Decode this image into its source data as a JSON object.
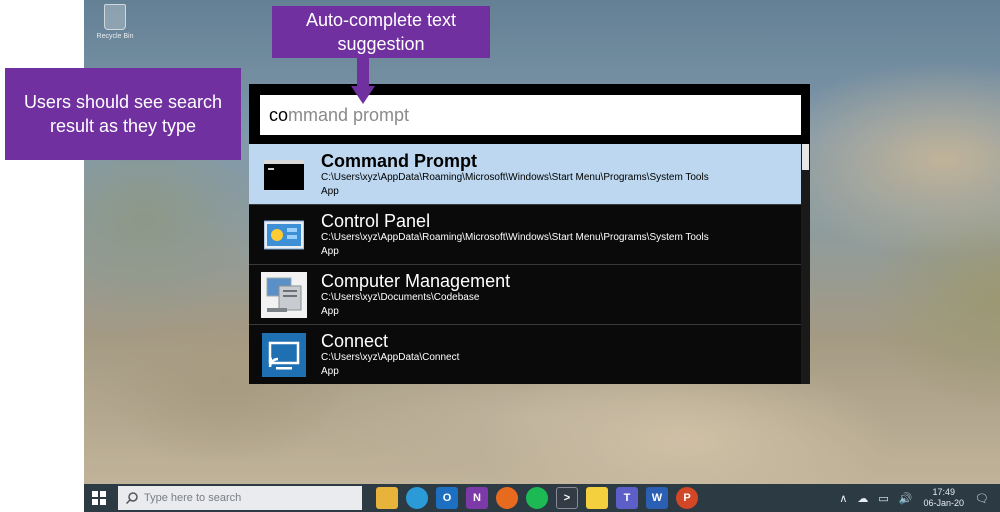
{
  "annotations": {
    "left_callout": "Users should see search result as they type",
    "top_callout": "Auto-complete text suggestion"
  },
  "desktop": {
    "recycle_bin_label": "Recycle Bin"
  },
  "search": {
    "typed": "co",
    "suggestion": "mmand prompt"
  },
  "results": [
    {
      "title": "Command Prompt",
      "path": "C:\\Users\\xyz\\AppData\\Roaming\\Microsoft\\Windows\\Start Menu\\Programs\\System Tools",
      "kind": "App",
      "icon": "command-prompt-icon",
      "selected": true
    },
    {
      "title": "Control Panel",
      "path": "C:\\Users\\xyz\\AppData\\Roaming\\Microsoft\\Windows\\Start Menu\\Programs\\System Tools",
      "kind": "App",
      "icon": "control-panel-icon",
      "selected": false
    },
    {
      "title": "Computer Management",
      "path": "C:\\Users\\xyz\\Documents\\Codebase",
      "kind": "App",
      "icon": "computer-management-icon",
      "selected": false
    },
    {
      "title": "Connect",
      "path": "C:\\Users\\xyz\\AppData\\Connect",
      "kind": "App",
      "icon": "connect-icon",
      "selected": false
    }
  ],
  "taskbar": {
    "search_placeholder": "Type here to search",
    "apps": [
      "file-explorer-icon",
      "edge-icon",
      "outlook-icon",
      "onenote-icon",
      "firefox-icon",
      "spotify-icon",
      "terminal-icon",
      "sticky-notes-icon",
      "teams-icon",
      "word-icon",
      "powerpoint-icon"
    ],
    "time": "17:49",
    "date": "06-Jan-20"
  },
  "colors": {
    "callout": "#7030a0",
    "selected_row": "#bcd7ef",
    "panel": "#000000",
    "taskbar": "#2c3a44"
  }
}
